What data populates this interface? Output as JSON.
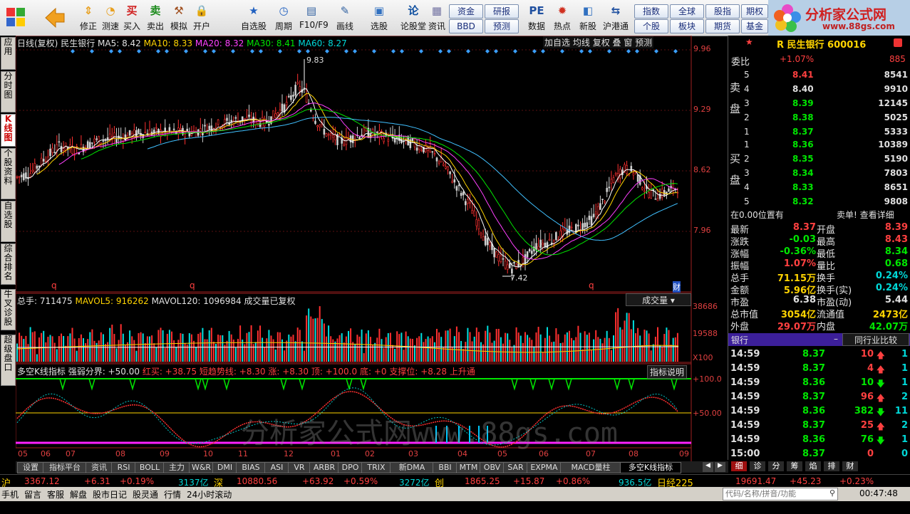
{
  "toolbar": {
    "buttons": [
      {
        "label": "修正",
        "icon": "up-down-arrow-icon"
      },
      {
        "label": "测速",
        "icon": "speed-icon"
      },
      {
        "label": "买入",
        "icon": "buy-icon"
      },
      {
        "label": "卖出",
        "icon": "sell-icon"
      },
      {
        "label": "模拟",
        "icon": "hammer-icon"
      },
      {
        "label": "开户",
        "icon": "lock-icon"
      },
      {
        "label": "自选股",
        "icon": "star-icon"
      },
      {
        "label": "周期",
        "icon": "clock-icon"
      },
      {
        "label": "F10/F9",
        "icon": "document-icon"
      },
      {
        "label": "画线",
        "icon": "pen-icon"
      },
      {
        "label": "选股",
        "icon": "monitor-icon"
      },
      {
        "label": "论股堂",
        "icon": "forum-icon"
      },
      {
        "label": "资讯",
        "icon": "news-icon"
      },
      {
        "label": "数据",
        "icon": "pe-icon"
      },
      {
        "label": "热点",
        "icon": "hot-icon"
      },
      {
        "label": "新股",
        "icon": "newstock-icon"
      },
      {
        "label": "沪港通",
        "icon": "shhk-icon"
      }
    ],
    "small_buttons": [
      "资金",
      "研报",
      "BBD",
      "预测",
      "指数",
      "全球",
      "股指",
      "期权",
      "个股",
      "板块",
      "期货",
      "基金"
    ],
    "logo_text": "分析家公式网",
    "logo_url": "www.88gs.com"
  },
  "left_tabs": [
    "应用",
    "分时图",
    "K线图",
    "个股资料",
    "自选股",
    "综合排名",
    "牛叉诊股",
    "超级盘口"
  ],
  "kline": {
    "header": {
      "period": "日线(复权)",
      "stock": "民生银行",
      "ma5": "MA5: 8.42",
      "ma10": "MA10: 8.33",
      "ma20": "MA20: 8.32",
      "ma30": "MA30: 8.41",
      "ma60": "MA60: 8.27"
    },
    "top_buttons": [
      "加自选",
      "均线",
      "复权",
      "叠",
      "窗",
      "预测"
    ],
    "y_ticks": [
      "9.96",
      "9.29",
      "8.62",
      "7.96"
    ],
    "high_label": "9.83",
    "low_label": "7.42",
    "q_marks": [
      "q",
      "q",
      "q"
    ],
    "fin_mark": "财"
  },
  "volume": {
    "header": {
      "total": "总手: 711475",
      "mavol5": "MAVOL5: 916262",
      "mavol120": "MAVOL120: 1096984",
      "note": "成交量已复权"
    },
    "selector": "成交量",
    "y_ticks": [
      "38686",
      "19588",
      "X100"
    ]
  },
  "indicator": {
    "header": {
      "name": "多空K线指标",
      "strength": "强弱分界: +50.00",
      "red_buy": "红买: +38.75",
      "short_trend": "短趋势线: +8.30",
      "up": "涨: +8.30",
      "top": "顶: +100.0",
      "bottom": "底: +0",
      "support": "支撑位: +8.28",
      "channel": "上升通"
    },
    "explain_button": "指标说明",
    "y_ticks": [
      "+100.0",
      "+50.00"
    ],
    "watermark": "分析家公式网www.88gs.com"
  },
  "x_axis": [
    "05",
    "06",
    "07",
    "08",
    "09",
    "10",
    "11",
    "12",
    "01",
    "02",
    "03",
    "04",
    "05",
    "06",
    "07",
    "08",
    "09"
  ],
  "right_panel": {
    "stock_title": "R 民生银行 600016",
    "weibi_label": "委比",
    "weibi_value": "+1.07%",
    "weibi_count": "885",
    "sell_label": "卖盘",
    "buy_label": "买盘",
    "sell": [
      {
        "lvl": "5",
        "price": "8.41",
        "vol": "8541"
      },
      {
        "lvl": "4",
        "price": "8.40",
        "vol": "9910"
      },
      {
        "lvl": "3",
        "price": "8.39",
        "vol": "12145"
      },
      {
        "lvl": "2",
        "price": "8.38",
        "vol": "5025"
      },
      {
        "lvl": "1",
        "price": "8.37",
        "vol": "5333"
      }
    ],
    "buy": [
      {
        "lvl": "1",
        "price": "8.36",
        "vol": "10389"
      },
      {
        "lvl": "2",
        "price": "8.35",
        "vol": "5190"
      },
      {
        "lvl": "3",
        "price": "8.34",
        "vol": "7803"
      },
      {
        "lvl": "4",
        "price": "8.33",
        "vol": "8651"
      },
      {
        "lvl": "5",
        "price": "8.32",
        "vol": "9808"
      }
    ],
    "position_text": "在0.00位置有",
    "detail_link": "卖单! 查看详细",
    "stats": [
      {
        "l1": "最新",
        "v1": "8.37",
        "l2": "开盘",
        "v2": "8.39"
      },
      {
        "l1": "涨跌",
        "v1": "-0.03",
        "l2": "最高",
        "v2": "8.43"
      },
      {
        "l1": "涨幅",
        "v1": "-0.36%",
        "l2": "最低",
        "v2": "8.34"
      },
      {
        "l1": "振幅",
        "v1": "1.07%",
        "l2": "量比",
        "v2": "0.68"
      },
      {
        "l1": "总手",
        "v1": "71.15万",
        "l2": "换手",
        "v2": "0.24%"
      },
      {
        "l1": "金额",
        "v1": "5.96亿",
        "l2": "换手(实)",
        "v2": "0.24%"
      },
      {
        "l1": "市盈",
        "v1": "6.38",
        "l2": "市盈(动)",
        "v2": "5.44"
      },
      {
        "l1": "总市值",
        "v1": "3054亿",
        "l2": "流通值",
        "v2": "2473亿"
      },
      {
        "l1": "外盘",
        "v1": "29.07万",
        "l2": "内盘",
        "v2": "42.07万"
      }
    ],
    "sector_label": "银行",
    "sector_minus": "–",
    "compare_button": "同行业比较",
    "ticks": [
      {
        "time": "14:59",
        "price": "8.37",
        "vol": "10",
        "dir": "up",
        "n": "1"
      },
      {
        "time": "14:59",
        "price": "8.37",
        "vol": "4",
        "dir": "up",
        "n": "1"
      },
      {
        "time": "14:59",
        "price": "8.36",
        "vol": "10",
        "dir": "down",
        "n": "1"
      },
      {
        "time": "14:59",
        "price": "8.37",
        "vol": "96",
        "dir": "up",
        "n": "2"
      },
      {
        "time": "14:59",
        "price": "8.36",
        "vol": "382",
        "dir": "down",
        "n": "11"
      },
      {
        "time": "14:59",
        "price": "8.37",
        "vol": "25",
        "dir": "up",
        "n": "2"
      },
      {
        "time": "14:59",
        "price": "8.36",
        "vol": "76",
        "dir": "down",
        "n": "1"
      },
      {
        "time": "15:00",
        "price": "8.37",
        "vol": "0",
        "dir": "none",
        "n": "0"
      }
    ],
    "bottom_tabs": [
      "细",
      "诊",
      "分",
      "筹",
      "焰",
      "排",
      "财"
    ]
  },
  "bottom_tabs": [
    "设置",
    "指标平台",
    "资讯",
    "RSI",
    "BOLL",
    "主力",
    "W&R",
    "DMI",
    "BIAS",
    "ASI",
    "VR",
    "ARBR",
    "DPO",
    "TRIX",
    "新DMA",
    "BBI",
    "MTM",
    "OBV",
    "SAR",
    "EXPMA",
    "MACD量柱",
    "多空K线指标"
  ],
  "status_line": {
    "sh_label": "沪",
    "sh_index": "3367.12",
    "sh_change": "+6.31",
    "sh_pct": "+0.19%",
    "sh_amount": "3137亿",
    "sz_label": "深",
    "sz_index": "10880.56",
    "sz_change": "+63.92",
    "sz_pct": "+0.59%",
    "sz_amount": "3272亿",
    "cy_label": "创",
    "cy_index": "1865.25",
    "cy_change": "+15.87",
    "cy_pct": "+0.86%",
    "cy_amount": "936.5亿",
    "nk_label": "日经225",
    "nk_index": "19691.47",
    "nk_change": "+45.23",
    "nk_pct": "+0.23%"
  },
  "status_bar": {
    "items": [
      "手机",
      "留言",
      "客服",
      "解盘",
      "股市日记",
      "股灵通",
      "行情",
      "24小时滚动"
    ],
    "search_placeholder": "代码/名称/拼音/功能",
    "time": "00:47:48"
  }
}
